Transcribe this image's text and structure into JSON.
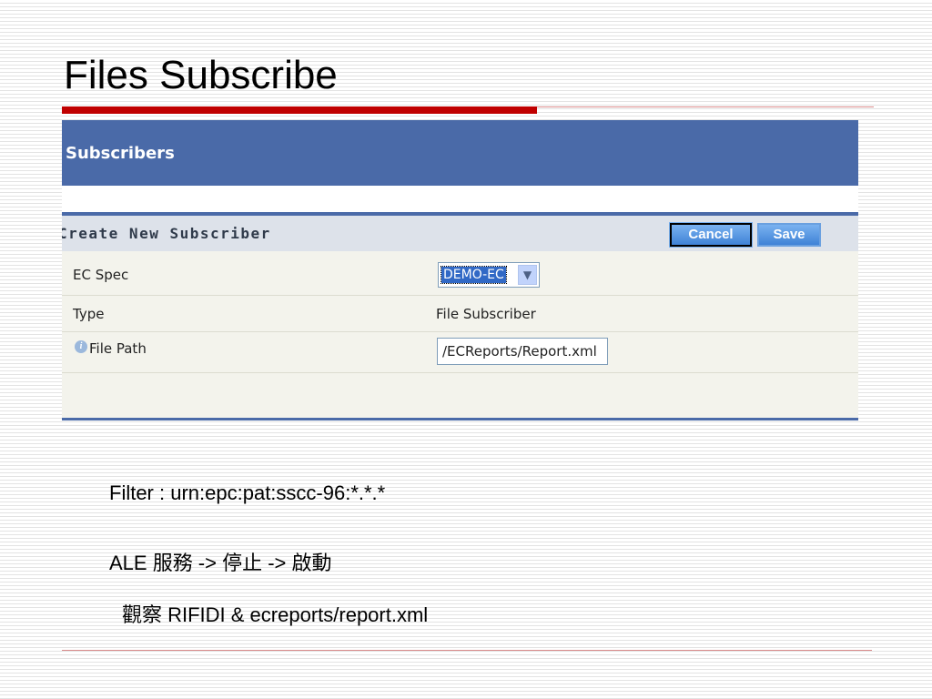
{
  "slide": {
    "title": "Files Subscribe",
    "notes": [
      "Filter : urn:epc:pat:sscc-96:*.*.*",
      "ALE 服務 -> 停止 -> 啟動",
      "觀察 RIFIDI & ecreports/report.xml"
    ]
  },
  "screenshot": {
    "header_title": "Subscribers",
    "panel": {
      "title": "Create New Subscriber",
      "buttons": {
        "cancel": "Cancel",
        "save": "Save"
      },
      "rows": {
        "ec_spec": {
          "label": "EC Spec",
          "value": "DEMO-EC"
        },
        "type": {
          "label": "Type",
          "value": "File Subscriber"
        },
        "file_path": {
          "label": "File Path",
          "value": "/ECReports/Report.xml"
        }
      }
    }
  },
  "colors": {
    "header_blue": "#4a6aa8",
    "title_rule_red": "#c00000",
    "button_blue": "#3f82d6"
  },
  "icons": {
    "info": "info-icon",
    "dropdown": "chevron-down-icon"
  }
}
